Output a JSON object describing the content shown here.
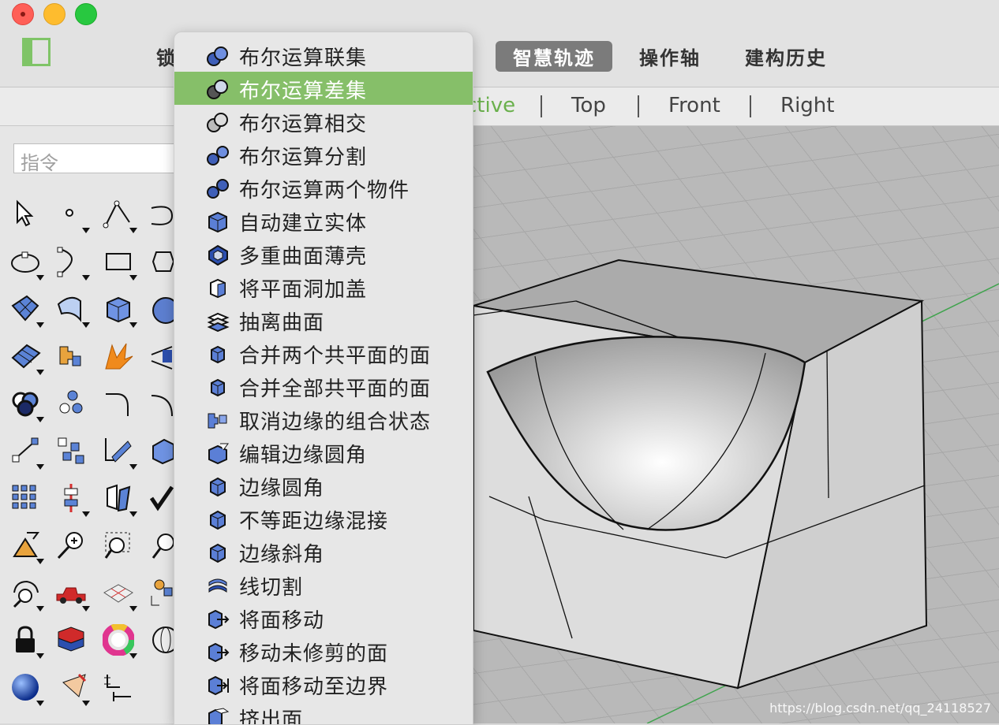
{
  "window": {
    "toolbar_items": {
      "lock": "锁",
      "smart_track": "智慧轨迹",
      "gumball": "操作轴",
      "history": "建构历史"
    }
  },
  "viewport_tabs": [
    {
      "label": "ctive",
      "active": true
    },
    {
      "label": "Top",
      "active": false
    },
    {
      "label": "Front",
      "active": false
    },
    {
      "label": "Right",
      "active": false
    }
  ],
  "command": {
    "placeholder": "指令"
  },
  "menu": {
    "items": [
      {
        "label": "布尔运算联集",
        "icon": "boolean-union-icon"
      },
      {
        "label": "布尔运算差集",
        "icon": "boolean-difference-icon",
        "highlighted": true
      },
      {
        "label": "布尔运算相交",
        "icon": "boolean-intersection-icon"
      },
      {
        "label": "布尔运算分割",
        "icon": "boolean-split-icon"
      },
      {
        "label": "布尔运算两个物件",
        "icon": "boolean-two-objects-icon"
      },
      {
        "label": "自动建立实体",
        "icon": "create-solid-icon"
      },
      {
        "label": "多重曲面薄壳",
        "icon": "shell-icon"
      },
      {
        "label": "将平面洞加盖",
        "icon": "cap-icon"
      },
      {
        "label": "抽离曲面",
        "icon": "extract-surface-icon"
      },
      {
        "label": "合并两个共平面的面",
        "icon": "merge-face-icon"
      },
      {
        "label": "合并全部共平面的面",
        "icon": "merge-all-faces-icon"
      },
      {
        "label": "取消边缘的组合状态",
        "icon": "unjoin-edge-icon"
      },
      {
        "label": "编辑边缘圆角",
        "icon": "edit-fillet-edge-icon"
      },
      {
        "label": "边缘圆角",
        "icon": "fillet-edge-icon"
      },
      {
        "label": "不等距边缘混接",
        "icon": "blend-edge-icon"
      },
      {
        "label": "边缘斜角",
        "icon": "chamfer-edge-icon"
      },
      {
        "label": "线切割",
        "icon": "wire-cut-icon"
      },
      {
        "label": "将面移动",
        "icon": "move-face-icon"
      },
      {
        "label": "移动未修剪的面",
        "icon": "move-untrimmed-face-icon"
      },
      {
        "label": "将面移动至边界",
        "icon": "move-face-to-boundary-icon"
      },
      {
        "label": "挤出面",
        "icon": "extrude-face-icon"
      }
    ]
  },
  "watermark": "https://blog.csdn.net/qq_24118527",
  "colors": {
    "highlight": "#86bf69",
    "active_tab": "#6ab04c",
    "smart_track_bg": "#7b7b7b"
  }
}
